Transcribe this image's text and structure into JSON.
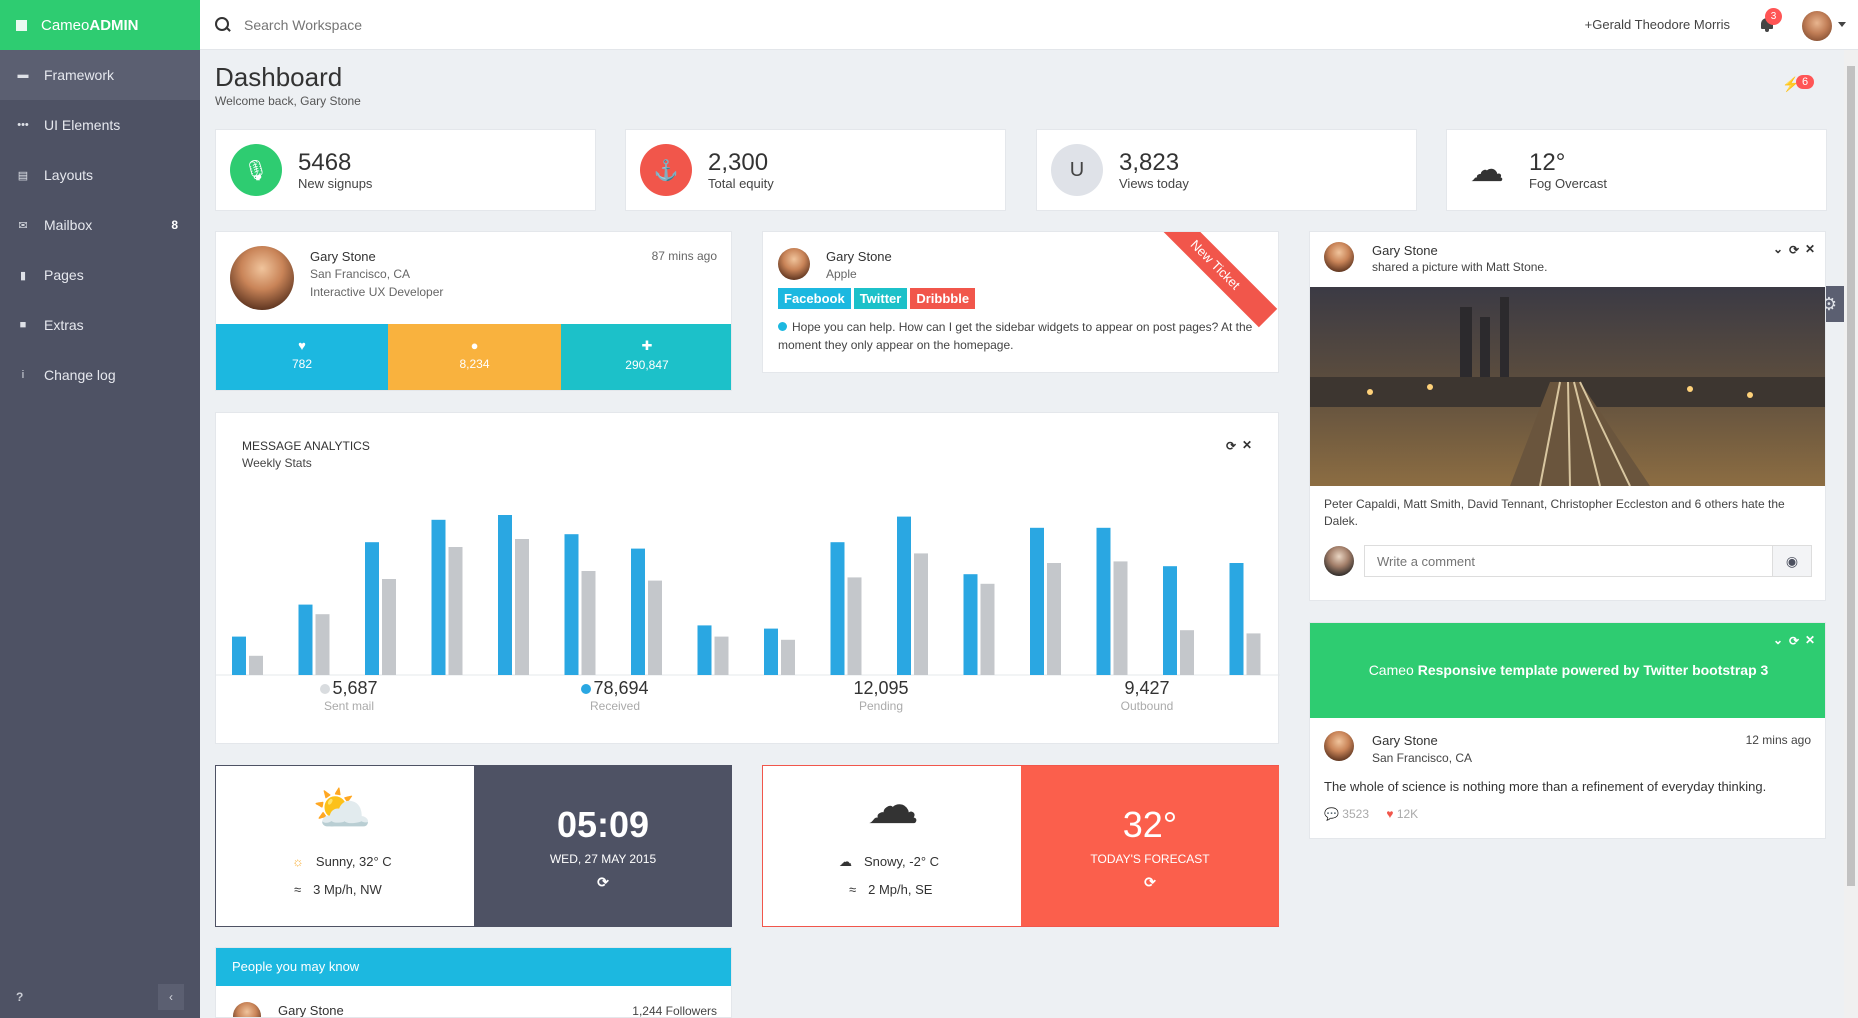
{
  "brand": {
    "prefix": "Cameo",
    "bold": "ADMIN"
  },
  "sidebar": {
    "items": [
      {
        "label": "Framework",
        "icon": "coffee-icon",
        "badge": ""
      },
      {
        "label": "UI Elements",
        "icon": "ellipsis-icon",
        "badge": ""
      },
      {
        "label": "Layouts",
        "icon": "layout-icon",
        "badge": ""
      },
      {
        "label": "Mailbox",
        "icon": "envelope-icon",
        "badge": "8"
      },
      {
        "label": "Pages",
        "icon": "file-icon",
        "badge": ""
      },
      {
        "label": "Extras",
        "icon": "gift-icon",
        "badge": ""
      },
      {
        "label": "Change log",
        "icon": "info-icon",
        "badge": ""
      }
    ]
  },
  "topbar": {
    "search_placeholder": "Search Workspace",
    "user": "+Gerald Theodore Morris",
    "notifications": "3"
  },
  "header": {
    "title": "Dashboard",
    "subtitle": "Welcome back, Gary Stone",
    "alerts": "6"
  },
  "stats": [
    {
      "value": "5468",
      "label": "New signups",
      "color": "#2ecc71",
      "icon": "microphone-icon"
    },
    {
      "value": "2,300",
      "label": "Total equity",
      "color": "#f1564b",
      "icon": "anchor-icon"
    },
    {
      "value": "3,823",
      "label": "Views today",
      "color": "#dfe2e8",
      "icon": "magnet-icon"
    },
    {
      "value": "12°",
      "label": "Fog Overcast",
      "color": "#ffffff",
      "icon": "fog-icon"
    }
  ],
  "profile": {
    "name": "Gary Stone",
    "location": "San Francisco, CA",
    "role": "Interactive UX Developer",
    "time": "87 mins ago",
    "counters": [
      {
        "value": "782",
        "icon": "heart-icon",
        "color": "#1cb8e0"
      },
      {
        "value": "8,234",
        "icon": "user-icon",
        "color": "#f9b23e"
      },
      {
        "value": "290,847",
        "icon": "plus-icon",
        "color": "#1cc1c9"
      }
    ]
  },
  "ticket": {
    "name": "Gary Stone",
    "company": "Apple",
    "tags": [
      {
        "label": "Facebook",
        "color": "#1cb8e0"
      },
      {
        "label": "Twitter",
        "color": "#1cc1c9"
      },
      {
        "label": "Dribbble",
        "color": "#f1564b"
      }
    ],
    "ribbon": "New Ticket",
    "message": "Hope you can help. How can I get the sidebar widgets to appear on post pages? At the moment they only appear on the homepage."
  },
  "analytics": {
    "title": "MESSAGE ANALYTICS",
    "subtitle": "Weekly Stats",
    "summary": [
      {
        "value": "5,687",
        "label": "Sent mail",
        "dot": "#d9dcdf"
      },
      {
        "value": "78,694",
        "label": "Received",
        "dot": "#2aa7e2"
      },
      {
        "value": "12,095",
        "label": "Pending",
        "dot": ""
      },
      {
        "value": "9,427",
        "label": "Outbound",
        "dot": ""
      }
    ]
  },
  "chart_data": {
    "type": "bar",
    "series": [
      {
        "values": [
          24,
          44,
          83,
          97,
          100,
          88,
          79,
          31,
          29,
          83,
          99,
          63,
          92,
          92,
          68,
          70
        ],
        "color": "#2aa7e2"
      },
      {
        "values": [
          12,
          38,
          60,
          80,
          85,
          65,
          59,
          24,
          22,
          61,
          76,
          57,
          70,
          71,
          28,
          26
        ],
        "color": "#c4c7cb"
      }
    ],
    "ylim": [
      0,
      100
    ],
    "grid": false
  },
  "weather1": {
    "condition": "Sunny, 32° C",
    "wind": "3 Mp/h, NW",
    "time": "05:09",
    "date": "WED, 27 MAY 2015"
  },
  "weather2": {
    "condition": "Snowy, -2° C",
    "wind": "2 Mp/h, SE",
    "temp": "32°",
    "label": "TODAY'S FORECAST"
  },
  "people": {
    "title": "People you may know",
    "first_name": "Gary Stone",
    "first_followers": "1,244 Followers"
  },
  "social": {
    "name": "Gary Stone",
    "action": "shared a picture with Matt Stone.",
    "likes_text": "Peter Capaldi, Matt Smith, David Tennant, Christopher Eccleston and 6 others hate the Dalek.",
    "comment_placeholder": "Write a comment"
  },
  "promo": {
    "prefix": "Cameo ",
    "bold": "Responsive template powered by Twitter bootstrap 3"
  },
  "quote": {
    "name": "Gary Stone",
    "location": "San Francisco, CA",
    "time": "12 mins ago",
    "text": "The whole of science is nothing more than a refinement of everyday thinking.",
    "comments": "3523",
    "likes": "12K"
  }
}
